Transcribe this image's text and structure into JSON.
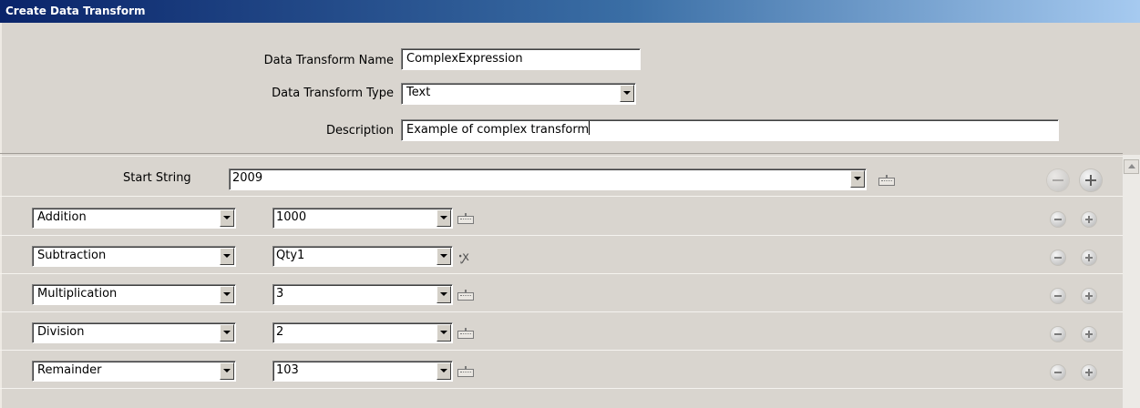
{
  "window": {
    "title": "Create Data Transform"
  },
  "form": {
    "name_label": "Data Transform Name",
    "name_value": "ComplexExpression",
    "type_label": "Data Transform Type",
    "type_value": "Text",
    "description_label": "Description",
    "description_value": "Example of complex transform"
  },
  "start": {
    "label": "Start String",
    "value": "2009",
    "input_icon": "keyboard-icon"
  },
  "operations": [
    {
      "operator": "Addition",
      "operand": "1000",
      "icon": "keyboard-icon"
    },
    {
      "operator": "Subtraction",
      "operand": "Qty1",
      "icon": "field-variable-icon"
    },
    {
      "operator": "Multiplication",
      "operand": "3",
      "icon": "keyboard-icon"
    },
    {
      "operator": "Division",
      "operand": "2",
      "icon": "keyboard-icon"
    },
    {
      "operator": "Remainder",
      "operand": "103",
      "icon": "keyboard-icon"
    }
  ],
  "colors": {
    "title_gradient_start": "#0a246a",
    "title_gradient_end": "#a6caf0",
    "background": "#d9d5cf"
  }
}
